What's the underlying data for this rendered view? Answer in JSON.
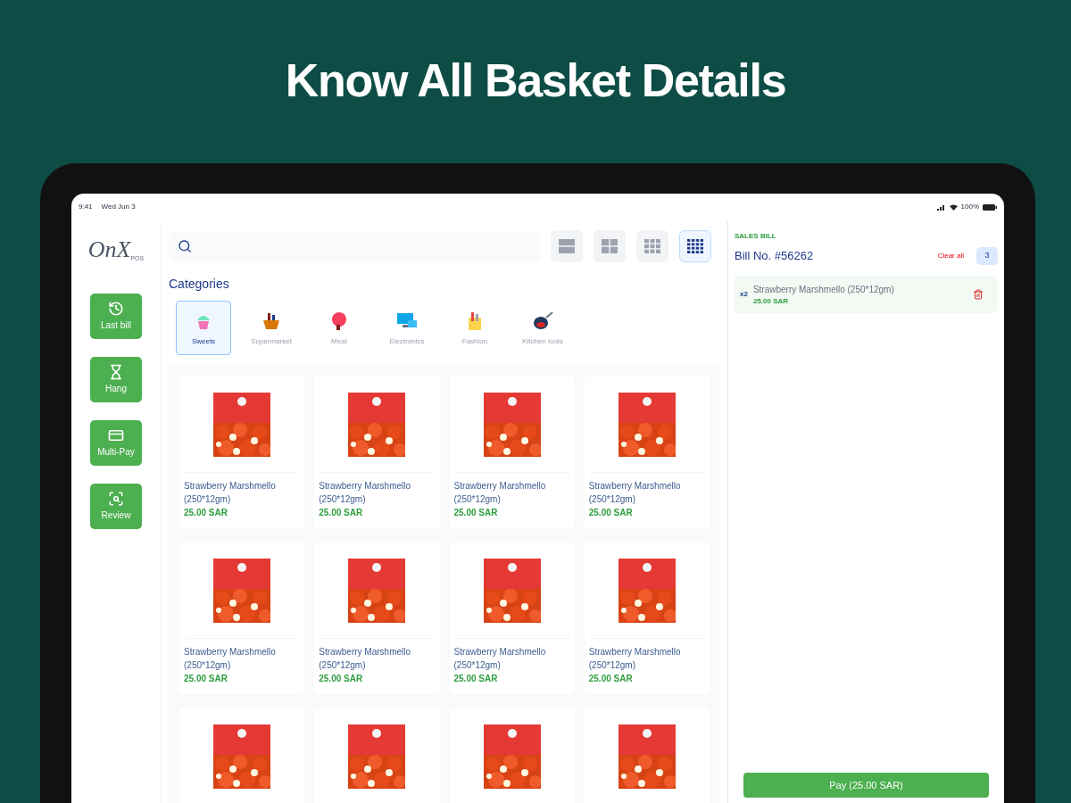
{
  "headline": "Know All Basket Details",
  "status_bar": {
    "time": "9:41",
    "date": "Wed Jun 3",
    "battery": "100%"
  },
  "logo": {
    "text": "OnX",
    "sub": "POS"
  },
  "sidebar": {
    "items": [
      {
        "label": "Last bill"
      },
      {
        "label": "Hang"
      },
      {
        "label": "Multi-Pay"
      },
      {
        "label": "Review"
      }
    ]
  },
  "view_modes": [
    {
      "selected": false
    },
    {
      "selected": false
    },
    {
      "selected": false
    },
    {
      "selected": true
    }
  ],
  "categories": {
    "title": "Categories",
    "items": [
      {
        "label": "Sweets",
        "selected": true
      },
      {
        "label": "Supermarket",
        "selected": false
      },
      {
        "label": "Meat",
        "selected": false
      },
      {
        "label": "Electronics",
        "selected": false
      },
      {
        "label": "Fashion",
        "selected": false
      },
      {
        "label": "Kitchen tools",
        "selected": false
      }
    ]
  },
  "products": [
    {
      "kind": "full",
      "name": "Strawberry Marshmello (250*12gm)",
      "price": "25.00 SAR"
    },
    {
      "kind": "full",
      "name": "Strawberry Marshmello (250*12gm)",
      "price": "25.00 SAR"
    },
    {
      "kind": "full",
      "name": "Strawberry Marshmello (250*12gm)",
      "price": "25.00 SAR"
    },
    {
      "kind": "full",
      "name": "Strawberry Marshmello (250*12gm)",
      "price": "25.00 SAR"
    },
    {
      "kind": "full",
      "name": "Strawberry Marshmello (250*12gm)",
      "price": "25.00 SAR"
    },
    {
      "kind": "full",
      "name": "Strawberry Marshmello (250*12gm)",
      "price": "25.00 SAR"
    },
    {
      "kind": "full",
      "name": "Strawberry Marshmello (250*12gm)",
      "price": "25.00 SAR"
    },
    {
      "kind": "full",
      "name": "Strawberry Marshmello (250*12gm)",
      "price": "25.00 SAR"
    },
    {
      "kind": "picture"
    },
    {
      "kind": "picture"
    },
    {
      "kind": "picture"
    },
    {
      "kind": "picture"
    }
  ],
  "bill": {
    "label": "SALES BILL",
    "number": "Bill No. #56262",
    "clear": "Clear all",
    "count": "3",
    "items": [
      {
        "qty": "x2",
        "name": "Strawberry Marshmello (250*12gm)",
        "price": "25.00 SAR"
      }
    ],
    "pay": "Pay (25.00 SAR)"
  }
}
